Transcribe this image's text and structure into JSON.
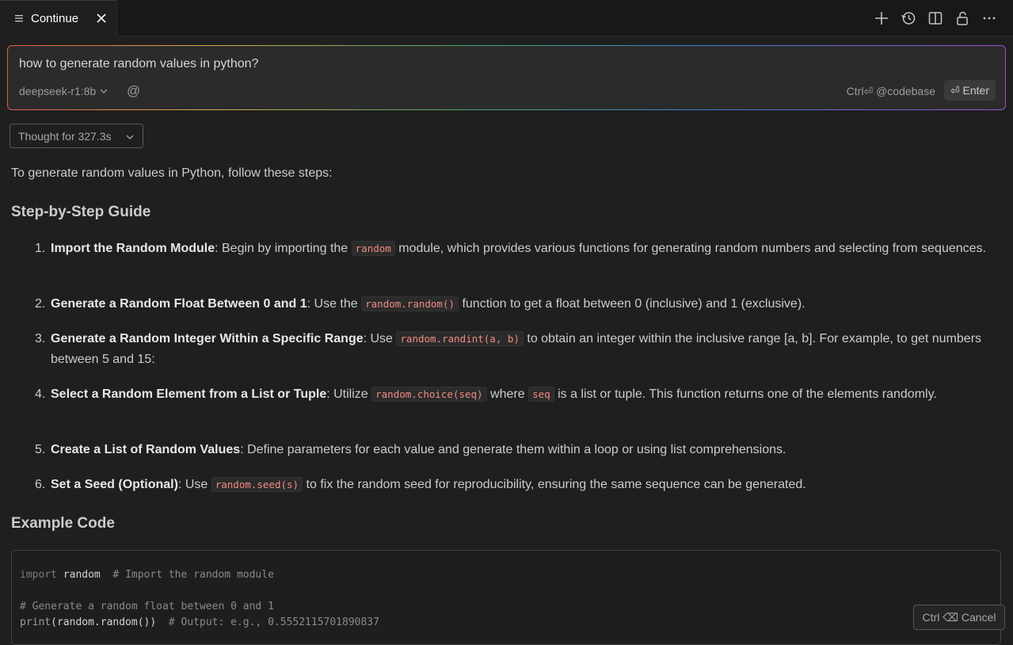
{
  "tab": {
    "title": "Continue",
    "icon": "list-icon",
    "close_icon": "close-icon"
  },
  "toolbar": {
    "icons": [
      "plus-icon",
      "history-icon",
      "split-panel-icon",
      "lock-icon",
      "more-icon"
    ]
  },
  "input": {
    "query": "how to generate random values in python?",
    "model": "deepseek-r1:8b",
    "at_symbol": "@",
    "hint": "Ctrl⏎ @codebase",
    "enter_label": "⏎ Enter"
  },
  "thought": {
    "label": "Thought for 327.3s"
  },
  "response": {
    "intro": "To generate random values in Python, follow these steps:",
    "guide_heading": "Step-by-Step Guide",
    "steps": [
      {
        "num": "1.",
        "title": "Import the Random Module",
        "t1": ": Begin by importing the ",
        "c1": "random",
        "t2": " module, which provides various functions for generating random numbers and selecting from sequences."
      },
      {
        "num": "2.",
        "title": "Generate a Random Float Between 0 and 1",
        "t1": ": Use the ",
        "c1": "random.random()",
        "t2": " function to get a float between 0 (inclusive) and 1 (exclusive)."
      },
      {
        "num": "3.",
        "title": "Generate a Random Integer Within a Specific Range",
        "t1": ": Use ",
        "c1": "random.randint(a, b)",
        "t2": " to obtain an integer within the inclusive range [a, b]. For example, to get numbers between 5 and 15:"
      },
      {
        "num": "4.",
        "title": "Select a Random Element from a List or Tuple",
        "t1": ": Utilize ",
        "c1": "random.choice(seq)",
        "t2": " where ",
        "c2": "seq",
        "t3": " is a list or tuple. This function returns one of the elements randomly."
      },
      {
        "num": "5.",
        "title": "Create a List of Random Values",
        "t1": ": Define parameters for each value and generate them within a loop or using list comprehensions."
      },
      {
        "num": "6.",
        "title": "Set a Seed (Optional)",
        "t1": ": Use ",
        "c1": "random.seed(s)",
        "t2": " to fix the random seed for reproducibility, ensuring the same sequence can be generated."
      }
    ],
    "example_heading": "Example Code",
    "code": {
      "l1_kw": "import",
      "l1_id": " random",
      "l1_cmt": "  # Import the random module",
      "l2_cmt": "# Generate a random float between 0 and 1",
      "l3_fn": "print",
      "l3_id": "(random.random())",
      "l3_cmt": "  # Output: e.g., 0.5552115701890837"
    }
  },
  "cancel": {
    "label": "Ctrl ⌫ Cancel"
  }
}
